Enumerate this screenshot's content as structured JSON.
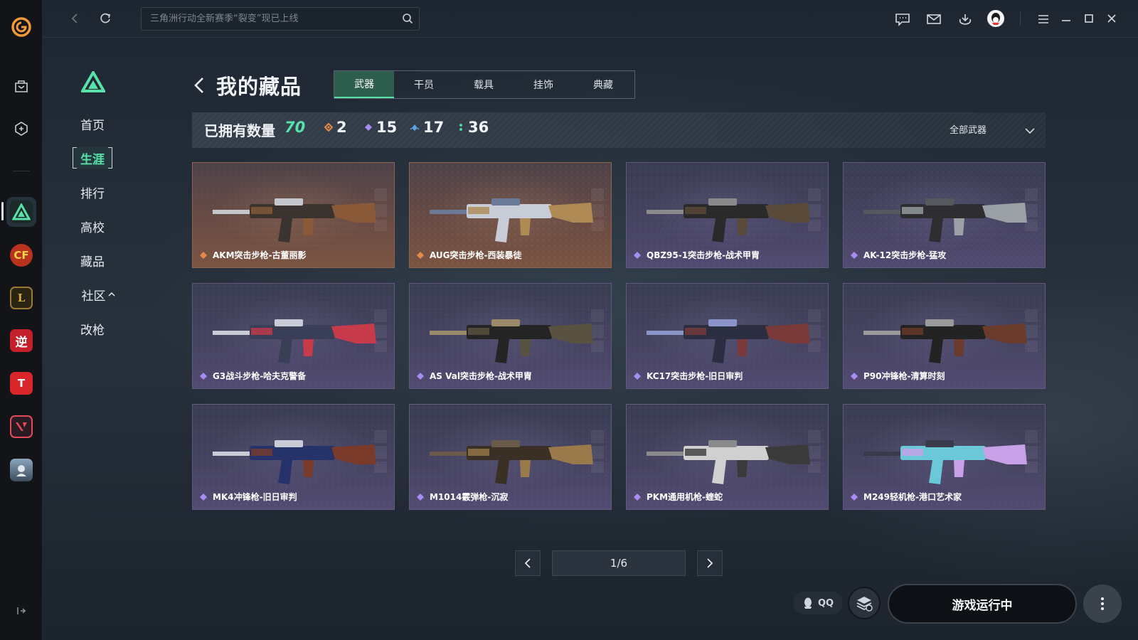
{
  "topbar": {
    "search_placeholder": "三角洲行动全新赛季“裂变”现已上线"
  },
  "side_nav": {
    "items": [
      {
        "label": "首页",
        "active": false
      },
      {
        "label": "生涯",
        "active": true
      },
      {
        "label": "排行",
        "active": false
      },
      {
        "label": "高校",
        "active": false
      },
      {
        "label": "藏品",
        "active": false
      },
      {
        "label": "社区",
        "active": false,
        "expand_icon": "chevron-up-icon"
      },
      {
        "label": "改枪",
        "active": false
      }
    ]
  },
  "page": {
    "title": "我的藏品",
    "tabs": [
      {
        "label": "武器",
        "active": true
      },
      {
        "label": "干员",
        "active": false
      },
      {
        "label": "载具",
        "active": false
      },
      {
        "label": "挂饰",
        "active": false
      },
      {
        "label": "典藏",
        "active": false
      }
    ]
  },
  "stats": {
    "owned_label": "已拥有数量",
    "owned_total": "70",
    "rarities": [
      {
        "color": "#e58a4a",
        "count": "2"
      },
      {
        "color": "#a98cf2",
        "count": "15"
      },
      {
        "color": "#5aa4e6",
        "count": "17"
      },
      {
        "color": "#4fd3a5",
        "count": "36"
      }
    ],
    "filter_label": "全部武器"
  },
  "collection": {
    "items": [
      {
        "name": "AKM突击步枪-古董丽影",
        "rarity": "orange"
      },
      {
        "name": "AUG突击步枪-西装暴徒",
        "rarity": "orange"
      },
      {
        "name": "QBZ95-1突击步枪-战术甲胄",
        "rarity": "purple"
      },
      {
        "name": "AK-12突击步枪-猛攻",
        "rarity": "purple"
      },
      {
        "name": "G3战斗步枪-哈夫克警备",
        "rarity": "purple"
      },
      {
        "name": "AS Val突击步枪-战术甲胄",
        "rarity": "purple"
      },
      {
        "name": "KC17突击步枪-旧日审判",
        "rarity": "purple"
      },
      {
        "name": "P90冲锋枪-清算时刻",
        "rarity": "purple"
      },
      {
        "name": "MK4冲锋枪-旧日审判",
        "rarity": "purple"
      },
      {
        "name": "M1014霰弹枪-沉寂",
        "rarity": "purple"
      },
      {
        "name": "PKM通用机枪-蝰蛇",
        "rarity": "purple"
      },
      {
        "name": "M249轻机枪-港口艺术家",
        "rarity": "purple"
      }
    ]
  },
  "pagination": {
    "page_text": "1/6"
  },
  "bottom_bar": {
    "qq_label": "QQ",
    "launch_label": "游戏运行中"
  },
  "rail": {
    "games": [
      "delta-force",
      "crossfire",
      "league-of-legends",
      "ni-shui-han",
      "tianya",
      "valorant",
      "pubg"
    ]
  }
}
